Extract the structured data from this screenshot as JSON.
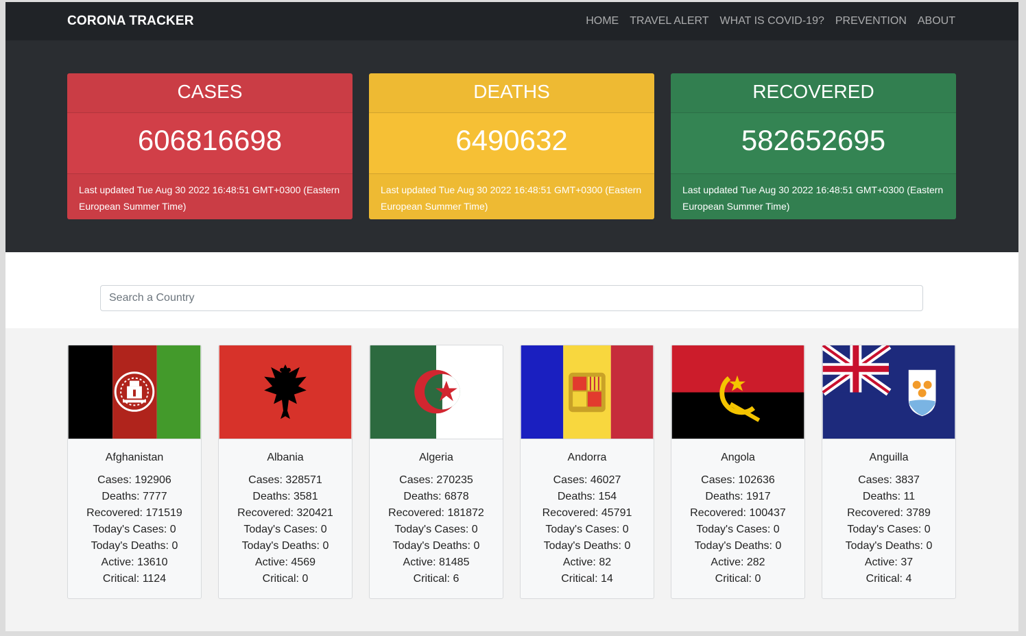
{
  "navbar": {
    "brand": "CORONA TRACKER",
    "links": [
      "HOME",
      "TRAVEL ALERT",
      "WHAT IS COVID-19?",
      "PREVENTION",
      "ABOUT"
    ]
  },
  "summary": {
    "cases": {
      "title": "CASES",
      "value": "606816698",
      "updated": "Last updated Tue Aug 30 2022 16:48:51 GMT+0300 (Eastern European Summer Time)",
      "color": "#d13f48"
    },
    "deaths": {
      "title": "DEATHS",
      "value": "6490632",
      "updated": "Last updated Tue Aug 30 2022 16:48:51 GMT+0300 (Eastern European Summer Time)",
      "color": "#f6c035"
    },
    "recovered": {
      "title": "RECOVERED",
      "value": "582652695",
      "updated": "Last updated Tue Aug 30 2022 16:48:51 GMT+0300 (Eastern European Summer Time)",
      "color": "#348453"
    }
  },
  "search": {
    "placeholder": "Search a Country"
  },
  "countries": [
    {
      "name": "Afghanistan",
      "flag_icon": "afghanistan-flag-icon",
      "stats": [
        "Cases: 192906",
        "Deaths: 7777",
        "Recovered: 171519",
        "Today's Cases: 0",
        "Today's Deaths: 0",
        "Active: 13610",
        "Critical: 1124"
      ]
    },
    {
      "name": "Albania",
      "flag_icon": "albania-flag-icon",
      "stats": [
        "Cases: 328571",
        "Deaths: 3581",
        "Recovered: 320421",
        "Today's Cases: 0",
        "Today's Deaths: 0",
        "Active: 4569",
        "Critical: 0"
      ]
    },
    {
      "name": "Algeria",
      "flag_icon": "algeria-flag-icon",
      "stats": [
        "Cases: 270235",
        "Deaths: 6878",
        "Recovered: 181872",
        "Today's Cases: 0",
        "Today's Deaths: 0",
        "Active: 81485",
        "Critical: 6"
      ]
    },
    {
      "name": "Andorra",
      "flag_icon": "andorra-flag-icon",
      "stats": [
        "Cases: 46027",
        "Deaths: 154",
        "Recovered: 45791",
        "Today's Cases: 0",
        "Today's Deaths: 0",
        "Active: 82",
        "Critical: 14"
      ]
    },
    {
      "name": "Angola",
      "flag_icon": "angola-flag-icon",
      "stats": [
        "Cases: 102636",
        "Deaths: 1917",
        "Recovered: 100437",
        "Today's Cases: 0",
        "Today's Deaths: 0",
        "Active: 282",
        "Critical: 0"
      ]
    },
    {
      "name": "Anguilla",
      "flag_icon": "anguilla-flag-icon",
      "stats": [
        "Cases: 3837",
        "Deaths: 11",
        "Recovered: 3789",
        "Today's Cases: 0",
        "Today's Deaths: 0",
        "Active: 37",
        "Critical: 4"
      ]
    }
  ]
}
